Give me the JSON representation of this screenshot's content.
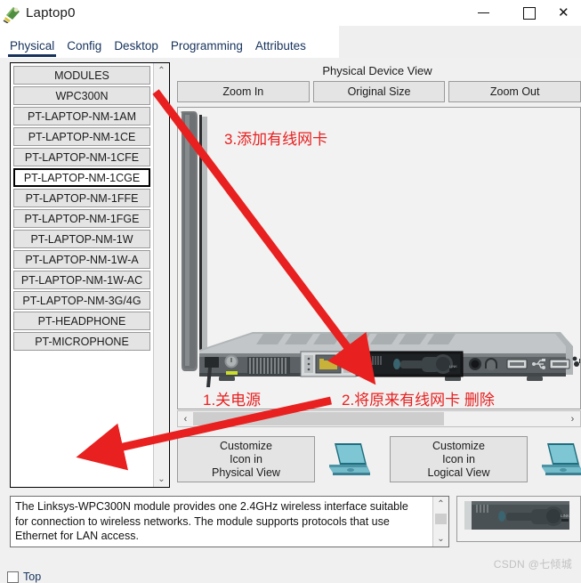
{
  "window": {
    "title": "Laptop0",
    "icon": "laptop-device-icon",
    "controls": {
      "minimize": "—",
      "maximize": "☐",
      "close": "✕"
    }
  },
  "tabs": [
    {
      "label": "Physical",
      "active": true
    },
    {
      "label": "Config",
      "active": false
    },
    {
      "label": "Desktop",
      "active": false
    },
    {
      "label": "Programming",
      "active": false
    },
    {
      "label": "Attributes",
      "active": false
    }
  ],
  "modules": {
    "header": "MODULES",
    "items": [
      {
        "label": "WPC300N",
        "selected": false
      },
      {
        "label": "PT-LAPTOP-NM-1AM",
        "selected": false
      },
      {
        "label": "PT-LAPTOP-NM-1CE",
        "selected": false
      },
      {
        "label": "PT-LAPTOP-NM-1CFE",
        "selected": false
      },
      {
        "label": "PT-LAPTOP-NM-1CGE",
        "selected": true
      },
      {
        "label": "PT-LAPTOP-NM-1FFE",
        "selected": false
      },
      {
        "label": "PT-LAPTOP-NM-1FGE",
        "selected": false
      },
      {
        "label": "PT-LAPTOP-NM-1W",
        "selected": false
      },
      {
        "label": "PT-LAPTOP-NM-1W-A",
        "selected": false
      },
      {
        "label": "PT-LAPTOP-NM-1W-AC",
        "selected": false
      },
      {
        "label": "PT-LAPTOP-NM-3G/4G",
        "selected": false
      },
      {
        "label": "PT-HEADPHONE",
        "selected": false
      },
      {
        "label": "PT-MICROPHONE",
        "selected": false
      }
    ],
    "scroll_up": "⌃",
    "scroll_down": "⌄"
  },
  "device_view": {
    "title": "Physical Device View",
    "zoom_in": "Zoom In",
    "original_size": "Original Size",
    "zoom_out": "Zoom Out",
    "hscroll_left": "‹",
    "hscroll_right": "›"
  },
  "customize": {
    "physical": {
      "line1": "Customize",
      "line2": "Icon in",
      "line3": "Physical View"
    },
    "logical": {
      "line1": "Customize",
      "line2": "Icon in",
      "line3": "Logical View"
    },
    "icon_name": "laptop-icon"
  },
  "description": {
    "text": "The Linksys-WPC300N module provides one 2.4GHz wireless interface suitable for connection to wireless networks. The module supports protocols that use Ethernet for LAN access.",
    "scroll_up": "⌃",
    "scroll_down": "⌄"
  },
  "bottom": {
    "top_checkbox_label": "Top",
    "watermark": "CSDN @七倾城"
  },
  "annotations": [
    {
      "id": "step3",
      "text": "3.添加有线网卡"
    },
    {
      "id": "step1",
      "text": "1.关电源"
    },
    {
      "id": "step2",
      "text": "2.将原来有线网卡 删除"
    }
  ],
  "colors": {
    "annotation_red": "#e8201f",
    "tab_active": "#16325c",
    "panel_gray": "#f0f0f0",
    "button_gray": "#e4e4e4"
  }
}
